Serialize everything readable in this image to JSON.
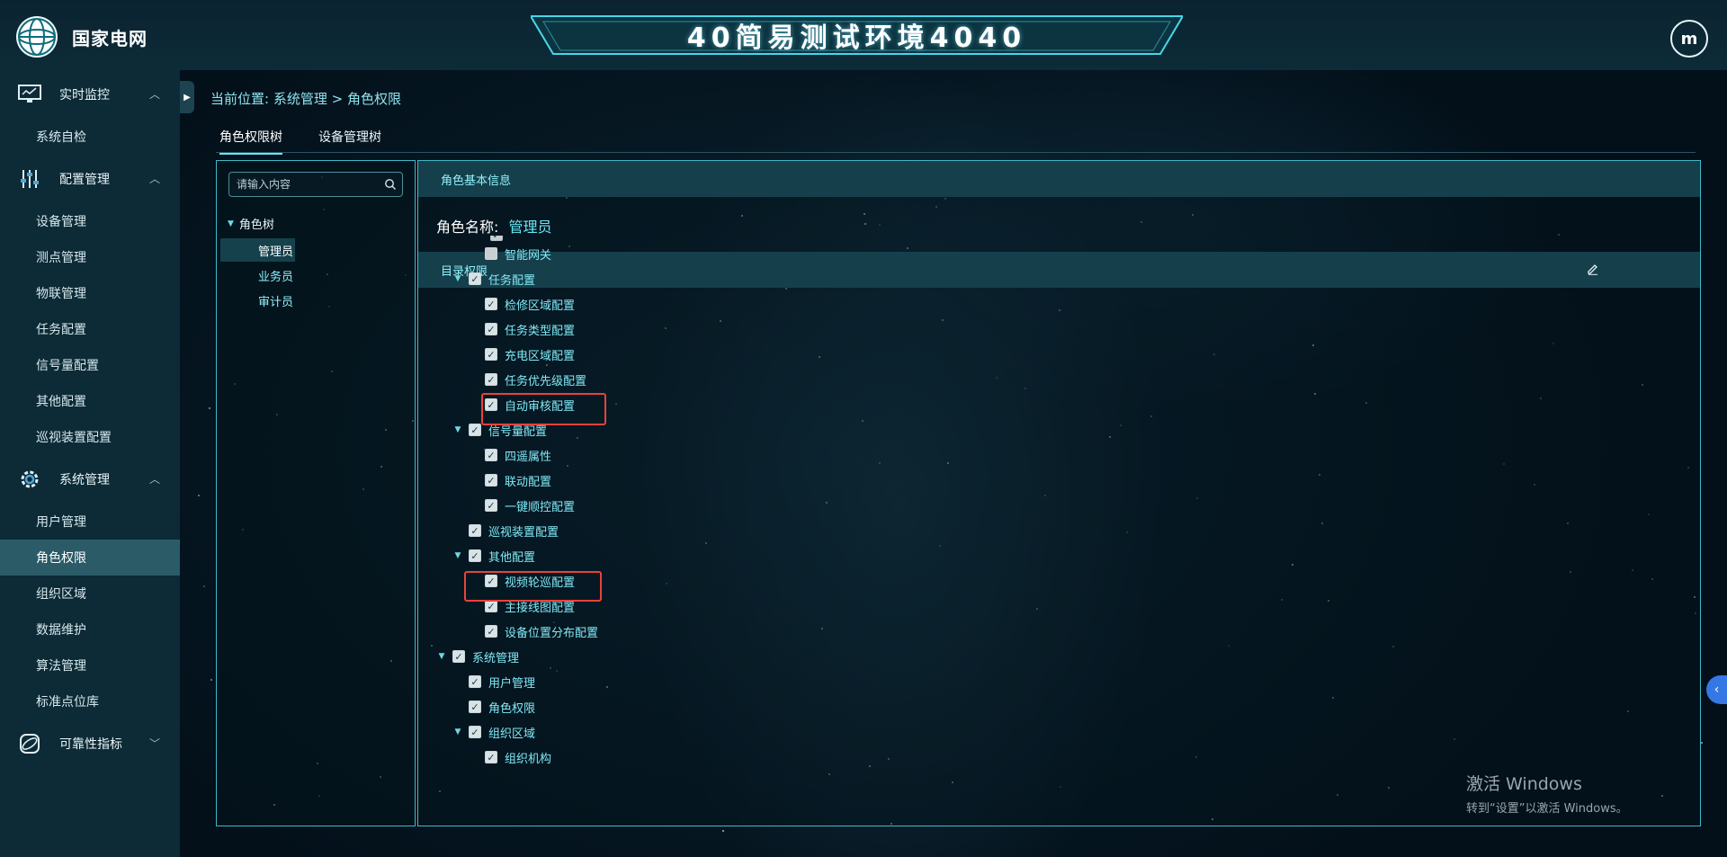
{
  "brand": {
    "name": "国家电网"
  },
  "header": {
    "title": "40简易测试环境4040",
    "avatar_letter": "m"
  },
  "sidebar": {
    "groups": [
      {
        "label": "实时监控",
        "icon": "monitor-icon",
        "items": [
          "系统自检"
        ]
      },
      {
        "label": "配置管理",
        "icon": "sliders-icon",
        "items": [
          "设备管理",
          "测点管理",
          "物联管理",
          "任务配置",
          "信号量配置",
          "其他配置",
          "巡视装置配置"
        ]
      },
      {
        "label": "系统管理",
        "icon": "gear-icon",
        "items": [
          "用户管理",
          "角色权限",
          "组织区域",
          "数据维护",
          "算法管理",
          "标准点位库"
        ]
      },
      {
        "label": "可靠性指标",
        "icon": "orbit-icon",
        "items": []
      }
    ],
    "active_item": "角色权限"
  },
  "breadcrumb": {
    "prefix": "当前位置:",
    "path1": "系统管理",
    "sep": ">",
    "path2": "角色权限"
  },
  "tabs": [
    "角色权限树",
    "设备管理树"
  ],
  "tree": {
    "search_placeholder": "请输入内容",
    "root": "角色树",
    "children": [
      "管理员",
      "业务员",
      "审计员"
    ],
    "selected": "管理员"
  },
  "role_info": {
    "section_title": "角色基本信息",
    "name_label": "角色名称:",
    "name_value": "管理员"
  },
  "permissions": {
    "section_title": "目录权限",
    "rows": [
      {
        "label": "智能网关",
        "level": 2,
        "checked": false,
        "expanded": null
      },
      {
        "label": "任务配置",
        "level": 1,
        "checked": true,
        "expanded": true
      },
      {
        "label": "检修区域配置",
        "level": 2,
        "checked": true,
        "expanded": null
      },
      {
        "label": "任务类型配置",
        "level": 2,
        "checked": true,
        "expanded": null
      },
      {
        "label": "充电区域配置",
        "level": 2,
        "checked": true,
        "expanded": null
      },
      {
        "label": "任务优先级配置",
        "level": 2,
        "checked": true,
        "expanded": null
      },
      {
        "label": "自动审核配置",
        "level": 2,
        "checked": true,
        "expanded": null
      },
      {
        "label": "信号量配置",
        "level": 1,
        "checked": true,
        "expanded": true
      },
      {
        "label": "四遥属性",
        "level": 2,
        "checked": true,
        "expanded": null
      },
      {
        "label": "联动配置",
        "level": 2,
        "checked": true,
        "expanded": null
      },
      {
        "label": "一键顺控配置",
        "level": 2,
        "checked": true,
        "expanded": null
      },
      {
        "label": "巡视装置配置",
        "level": 1,
        "checked": true,
        "expanded": null
      },
      {
        "label": "其他配置",
        "level": 1,
        "checked": true,
        "expanded": true
      },
      {
        "label": "视频轮巡配置",
        "level": 2,
        "checked": true,
        "expanded": null
      },
      {
        "label": "主接线图配置",
        "level": 2,
        "checked": true,
        "expanded": null
      },
      {
        "label": "设备位置分布配置",
        "level": 2,
        "checked": true,
        "expanded": null
      },
      {
        "label": "系统管理",
        "level": 0,
        "checked": true,
        "expanded": true
      },
      {
        "label": "用户管理",
        "level": 1,
        "checked": true,
        "expanded": null
      },
      {
        "label": "角色权限",
        "level": 1,
        "checked": true,
        "expanded": null
      },
      {
        "label": "组织区域",
        "level": 1,
        "checked": true,
        "expanded": true
      },
      {
        "label": "组织机构",
        "level": 2,
        "checked": true,
        "expanded": null
      }
    ]
  },
  "watermark": {
    "line1": "激活 Windows",
    "line2": "转到“设置”以激活 Windows。"
  },
  "colors": {
    "accent": "#6fe3f3",
    "highlight": "#e8433a",
    "sidebar_bg": "#0d2a37",
    "active_item": "#2a5b67"
  }
}
